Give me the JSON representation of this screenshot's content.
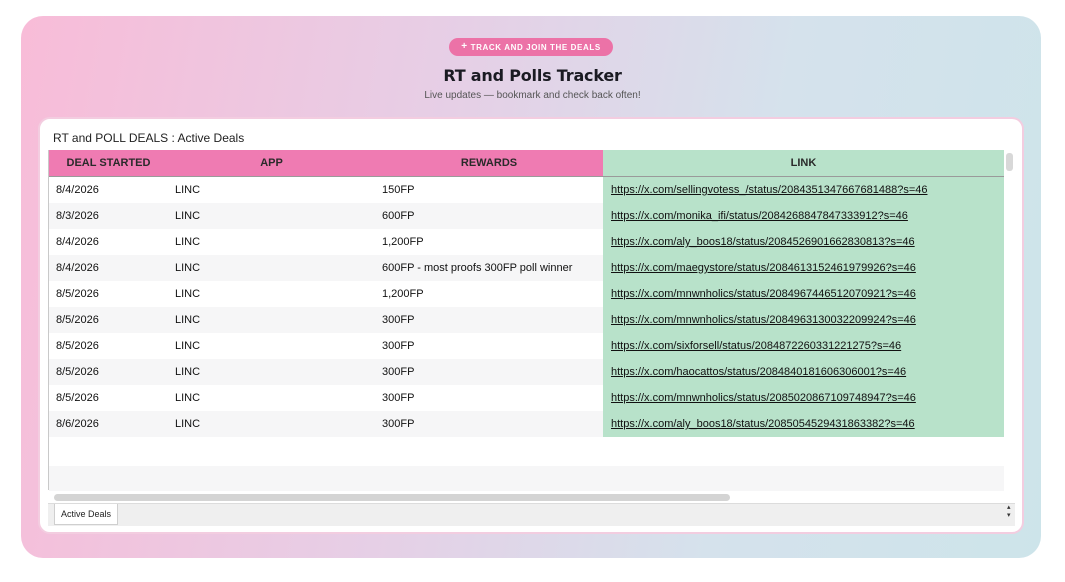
{
  "header": {
    "pill_label": "TRACK AND JOIN THE DEALS",
    "title": "RT and Polls Tracker",
    "subtitle": "Live updates — bookmark and check back often!"
  },
  "sheet": {
    "title": "RT and POLL DEALS : Active Deals",
    "columns": [
      "DEAL STARTED",
      "APP",
      "REWARDS",
      "LINK"
    ],
    "rows": [
      {
        "date": "8/4/2026",
        "app": "LINC",
        "reward": "150FP",
        "link": "https://x.com/sellingvotess_/status/2084351347667681488?s=46"
      },
      {
        "date": "8/3/2026",
        "app": "LINC",
        "reward": "600FP",
        "link": "https://x.com/monika_ifi/status/2084268847847333912?s=46"
      },
      {
        "date": "8/4/2026",
        "app": "LINC",
        "reward": "1,200FP",
        "link": "https://x.com/aly_boos18/status/2084526901662830813?s=46"
      },
      {
        "date": "8/4/2026",
        "app": "LINC",
        "reward": "600FP - most proofs 300FP poll winner",
        "link": "https://x.com/maegystore/status/2084613152461979926?s=46"
      },
      {
        "date": "8/5/2026",
        "app": "LINC",
        "reward": "1,200FP",
        "link": "https://x.com/mnwnholics/status/2084967446512070921?s=46"
      },
      {
        "date": "8/5/2026",
        "app": "LINC",
        "reward": "300FP",
        "link": "https://x.com/mnwnholics/status/2084963130032209924?s=46"
      },
      {
        "date": "8/5/2026",
        "app": "LINC",
        "reward": "300FP",
        "link": "https://x.com/sixforsell/status/2084872260331221275?s=46"
      },
      {
        "date": "8/5/2026",
        "app": "LINC",
        "reward": "300FP",
        "link": "https://x.com/haocattos/status/2084840181606306001?s=46"
      },
      {
        "date": "8/5/2026",
        "app": "LINC",
        "reward": "300FP",
        "link": "https://x.com/mnwnholics/status/2085020867109748947?s=46"
      },
      {
        "date": "8/6/2026",
        "app": "LINC",
        "reward": "300FP",
        "link": "https://x.com/aly_boos18/status/2085054529431863382?s=46"
      }
    ],
    "tab_label": "Active Deals"
  },
  "colors": {
    "pill": "#ec72a7",
    "header_pink": "#ef7bb2",
    "link_green": "#b8e2ca"
  }
}
